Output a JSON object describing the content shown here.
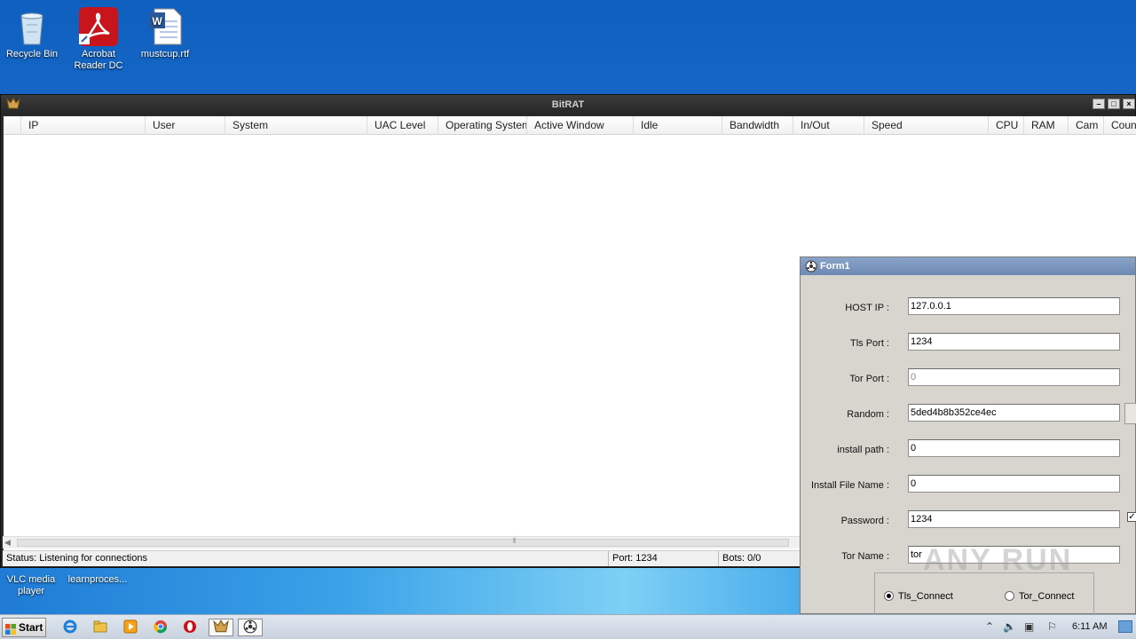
{
  "desktop": {
    "icons": [
      {
        "label": "Recycle Bin",
        "icon": "recycle-bin-icon"
      },
      {
        "label": "Acrobat Reader DC",
        "icon": "acrobat-icon"
      },
      {
        "label": "mustcup.rtf",
        "icon": "word-doc-icon"
      }
    ],
    "strip_items": [
      {
        "label": "VLC media player"
      },
      {
        "label": "learnproces..."
      }
    ]
  },
  "bitrat": {
    "title": "BitRAT",
    "columns": [
      "IP",
      "User",
      "System",
      "UAC Level",
      "Operating System",
      "Active Window",
      "Idle",
      "Bandwidth",
      "In/Out",
      "Speed",
      "CPU",
      "RAM",
      "Cam",
      "Count"
    ],
    "status": {
      "text": "Status: Listening for connections",
      "port": "Port: 1234",
      "bots": "Bots: 0/0"
    }
  },
  "form1": {
    "title": "Form1",
    "fields": [
      {
        "label": "HOST IP :",
        "value": "127.0.0.1"
      },
      {
        "label": "Tls Port :",
        "value": "1234"
      },
      {
        "label": "Tor Port :",
        "value": "0"
      },
      {
        "label": "Random :",
        "value": "5ded4b8b352ce4ec"
      },
      {
        "label": "install path :",
        "value": "0"
      },
      {
        "label": "Install File Name :",
        "value": "0"
      },
      {
        "label": "Password :",
        "value": "1234"
      },
      {
        "label": "Tor Name :",
        "value": "tor"
      }
    ],
    "radios": [
      {
        "label": "Tls_Connect",
        "checked": true
      },
      {
        "label": "Tor_Connect",
        "checked": false
      }
    ]
  },
  "watermark": "ANY RUN",
  "taskbar": {
    "start_label": "Start",
    "clock": "6:11 AM",
    "apps": [
      "ie-icon",
      "explorer-icon",
      "media-player-icon",
      "chrome-icon",
      "opera-icon",
      "bitrat-icon",
      "form1-app-icon"
    ]
  },
  "colors": {
    "desktop_blue": "#1f73cf",
    "window_title_dark": "#2a2a2a",
    "form_title": "#7a96bf"
  }
}
